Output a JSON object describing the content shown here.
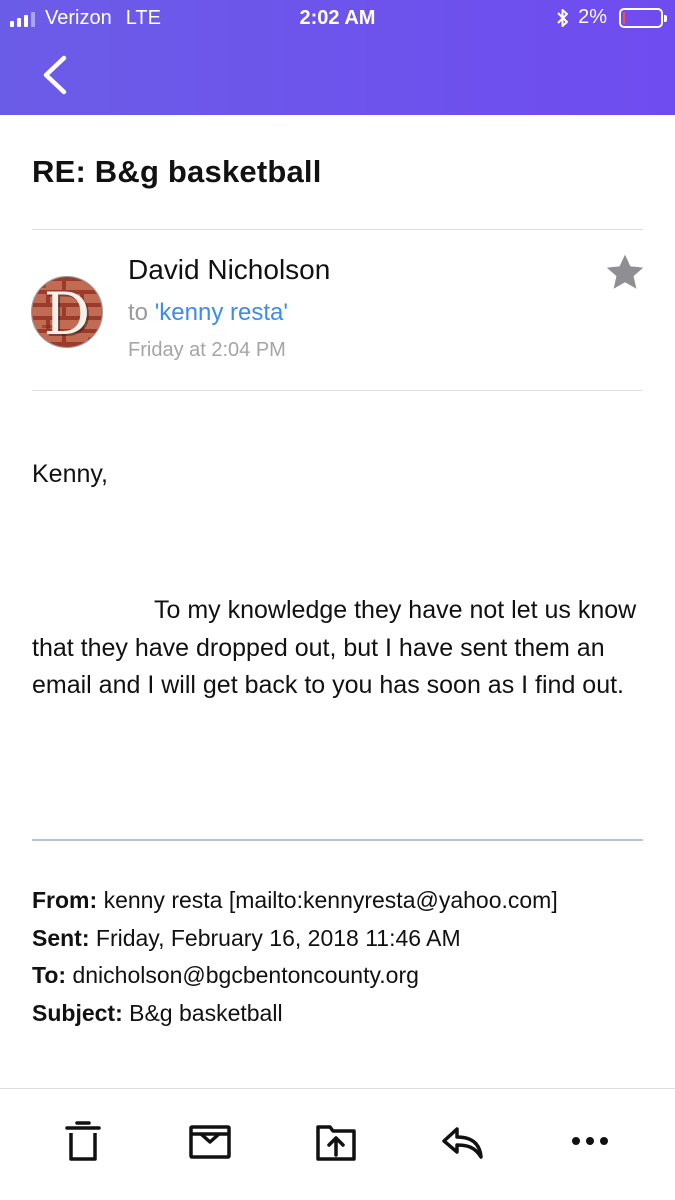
{
  "status_bar": {
    "carrier": "Verizon",
    "network": "LTE",
    "time": "2:02 AM",
    "battery_percent": "2%",
    "battery_level": 0.02,
    "signal_bars_active": 3,
    "signal_bars_total": 4
  },
  "nav": {
    "back_icon": "chevron-left-icon"
  },
  "email": {
    "subject": "RE: B&g basketball",
    "sender_name": "David Nicholson",
    "avatar_letter": "D",
    "to_prefix": "to",
    "to_name": "'kenny resta'",
    "date": "Friday at 2:04 PM",
    "starred": false,
    "greeting": "Kenny,",
    "paragraph": "To my knowledge they have not let us know that they have dropped out, but I have sent them an email and I will get back to you has soon as I find out.",
    "quoted_header": {
      "from_label": "From:",
      "from_value": "kenny resta [mailto:kennyresta@yahoo.com]",
      "sent_label": "Sent:",
      "sent_value": "Friday, February 16, 2018 11:46 AM",
      "to_label": "To:",
      "to_value": "dnicholson@bgcbentoncounty.org",
      "subject_label": "Subject:",
      "subject_value": "B&g basketball"
    }
  },
  "toolbar": {
    "items": [
      "trash-icon",
      "archive-icon",
      "move-icon",
      "reply-icon",
      "more-icon"
    ]
  },
  "colors": {
    "header_gradient_start": "#6b5ce7",
    "header_gradient_end": "#6f4cf0",
    "link_blue": "#3d8ce6",
    "battery_low": "#ff4b4b",
    "star_gray": "#8e8e93"
  }
}
